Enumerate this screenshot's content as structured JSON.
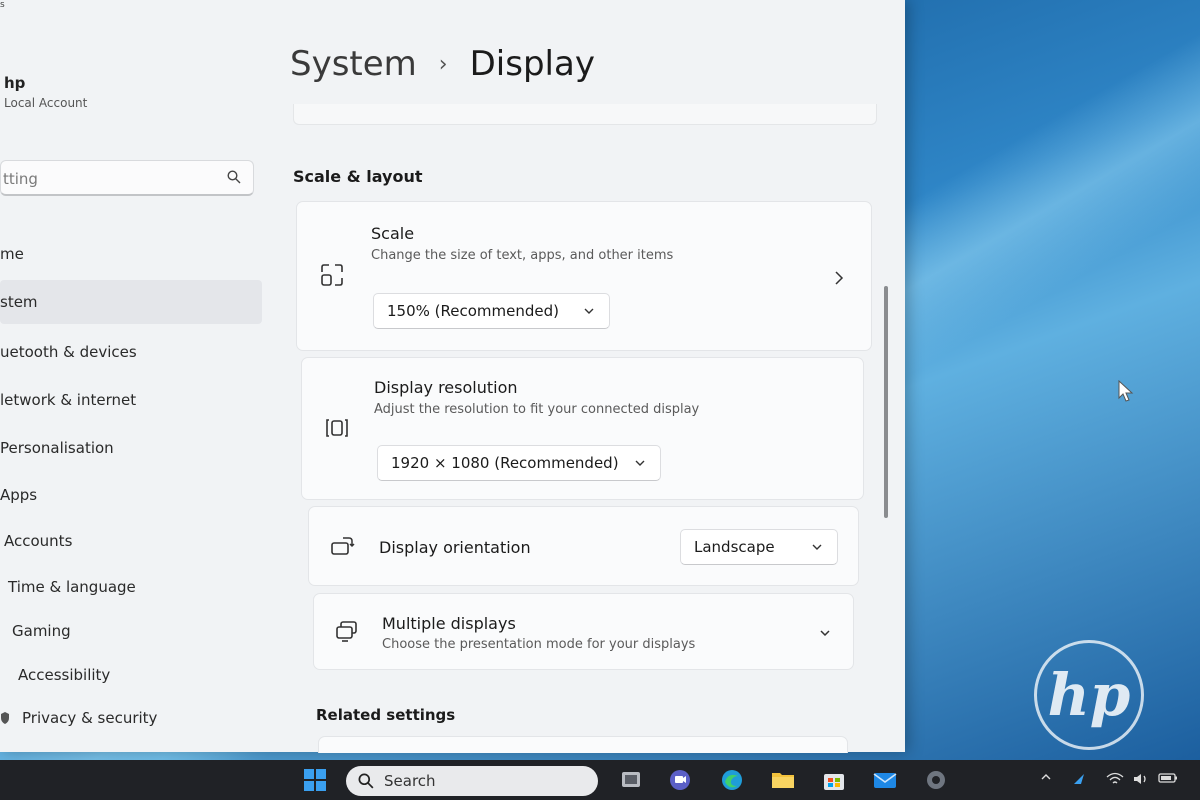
{
  "window": {
    "breadcrumb_parent": "System",
    "breadcrumb_separator": "›",
    "page_title": "Display"
  },
  "sidebar": {
    "corner_glyph": "s",
    "user_name": "hp",
    "account_type": "Local Account",
    "search_placeholder": "tting",
    "items": [
      {
        "label": "me",
        "active": false
      },
      {
        "label": "stem",
        "active": true
      },
      {
        "label": "uetooth & devices",
        "active": false
      },
      {
        "label": "letwork & internet",
        "active": false
      },
      {
        "label": "Personalisation",
        "active": false
      },
      {
        "label": "Apps",
        "active": false
      },
      {
        "label": "Accounts",
        "active": false
      },
      {
        "label": "Time & language",
        "active": false
      },
      {
        "label": "Gaming",
        "active": false
      },
      {
        "label": "Accessibility",
        "active": false
      },
      {
        "label": "Privacy & security",
        "active": false
      }
    ]
  },
  "main": {
    "section_title": "Scale & layout",
    "scale": {
      "title": "Scale",
      "subtitle": "Change the size of text, apps, and other items",
      "value": "150% (Recommended)"
    },
    "resolution": {
      "title": "Display resolution",
      "subtitle": "Adjust the resolution to fit your connected display",
      "value": "1920 × 1080 (Recommended)"
    },
    "orientation": {
      "title": "Display orientation",
      "value": "Landscape"
    },
    "multiple": {
      "title": "Multiple displays",
      "subtitle": "Choose the presentation mode for your displays"
    },
    "related_title": "Related settings"
  },
  "taskbar": {
    "search_label": "Search",
    "icons": [
      "windows-start-icon",
      "task-view-icon",
      "teams-chat-icon",
      "edge-icon",
      "file-explorer-icon",
      "store-icon",
      "mail-icon",
      "settings-icon"
    ]
  },
  "desktop": {
    "logo_text": "hp"
  },
  "colors": {
    "accent": "#0067c0",
    "window_bg": "#f1f3f5",
    "taskbar_bg": "#202226"
  }
}
